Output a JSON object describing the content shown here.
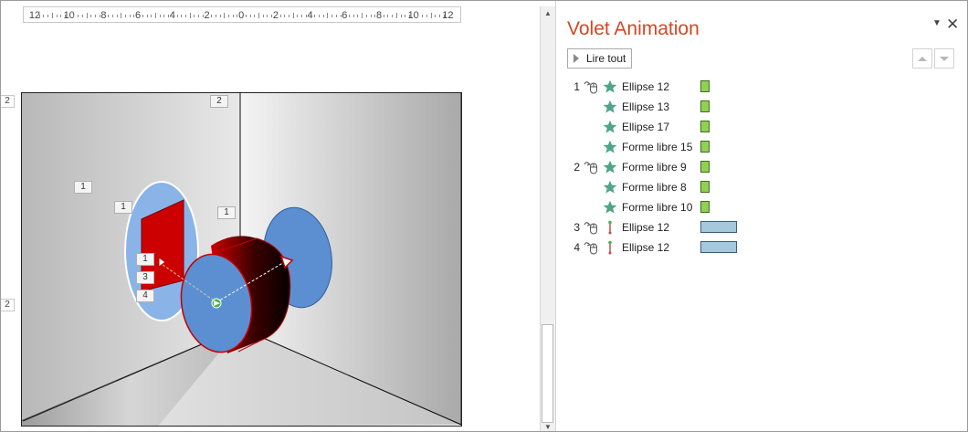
{
  "ruler": {
    "labels": [
      "12",
      "10",
      "8",
      "6",
      "4",
      "2",
      "0",
      "2",
      "4",
      "6",
      "8",
      "10",
      "12"
    ]
  },
  "vertical_ruler": {
    "top_mark": "2",
    "bottom_mark": "2"
  },
  "slide": {
    "tags": {
      "top_right": "2",
      "left_a": "1",
      "left_b": "1",
      "middle": "1",
      "seq_1": "1",
      "seq_3": "3",
      "seq_4": "4"
    },
    "colors": {
      "room_gray": "#bdbdbd",
      "ellipse_blue": "#5b8fd1",
      "ellipse_light_blue": "#8ab4e8",
      "red_shape": "#cc0000"
    }
  },
  "pane": {
    "title": "Volet Animation",
    "menu_icon": "chevron-down-icon",
    "close_icon": "close-icon",
    "play_label": "Lire tout",
    "title_color": "#d24726",
    "items": [
      {
        "num": "1",
        "trigger": "mouse-click-icon",
        "effect": "star-icon",
        "name": "Ellipse 12",
        "bar": "green"
      },
      {
        "num": "",
        "trigger": "",
        "effect": "star-icon",
        "name": "Ellipse 13",
        "bar": "green"
      },
      {
        "num": "",
        "trigger": "",
        "effect": "star-icon",
        "name": "Ellipse 17",
        "bar": "green"
      },
      {
        "num": "",
        "trigger": "",
        "effect": "star-icon",
        "name": "Forme libre 15",
        "bar": "green"
      },
      {
        "num": "2",
        "trigger": "mouse-click-icon",
        "effect": "star-icon",
        "name": "Forme libre 9",
        "bar": "green"
      },
      {
        "num": "",
        "trigger": "",
        "effect": "star-icon",
        "name": "Forme libre 8",
        "bar": "green"
      },
      {
        "num": "",
        "trigger": "",
        "effect": "star-icon",
        "name": "Forme libre 10",
        "bar": "green"
      },
      {
        "num": "3",
        "trigger": "mouse-click-icon",
        "effect": "motion-path-icon",
        "name": "Ellipse 12",
        "bar": "blue"
      },
      {
        "num": "4",
        "trigger": "mouse-click-icon",
        "effect": "motion-path-icon",
        "name": "Ellipse 12",
        "bar": "blue"
      }
    ]
  }
}
